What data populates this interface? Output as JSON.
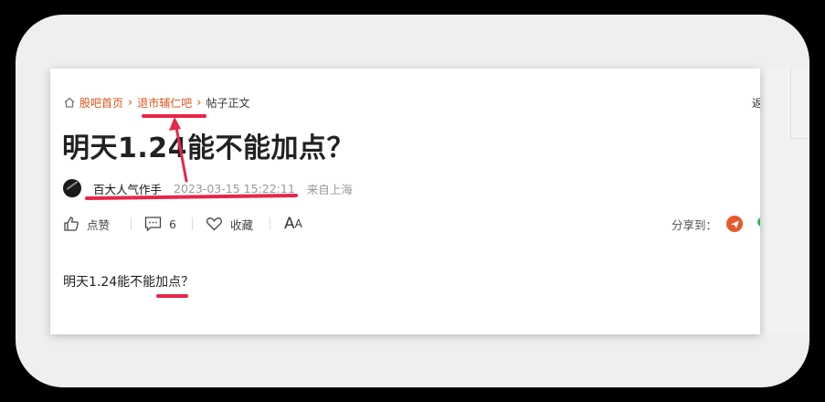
{
  "breadcrumb": {
    "home": "股吧首页",
    "forum": "退市辅仁吧",
    "current": "帖子正文"
  },
  "back_label": "返",
  "post": {
    "title": "明天1.24能不能加点？",
    "author": "百大人气作手",
    "time": "2023-03-15 15:22:11",
    "location": "来自上海",
    "body": "明天1.24能不能加点？"
  },
  "actions": {
    "like": "点赞",
    "comments_count": "6",
    "favorite": "收藏",
    "font_size": "A",
    "font_size_small": "A",
    "share_label": "分享到："
  },
  "icons": [
    "home-icon",
    "chevron-right-icon",
    "thumbs-up-icon",
    "comment-icon",
    "heart-icon",
    "share-paper-plane-icon"
  ],
  "colors": {
    "accent": "#e0541f",
    "annotation": "#e8264a"
  }
}
